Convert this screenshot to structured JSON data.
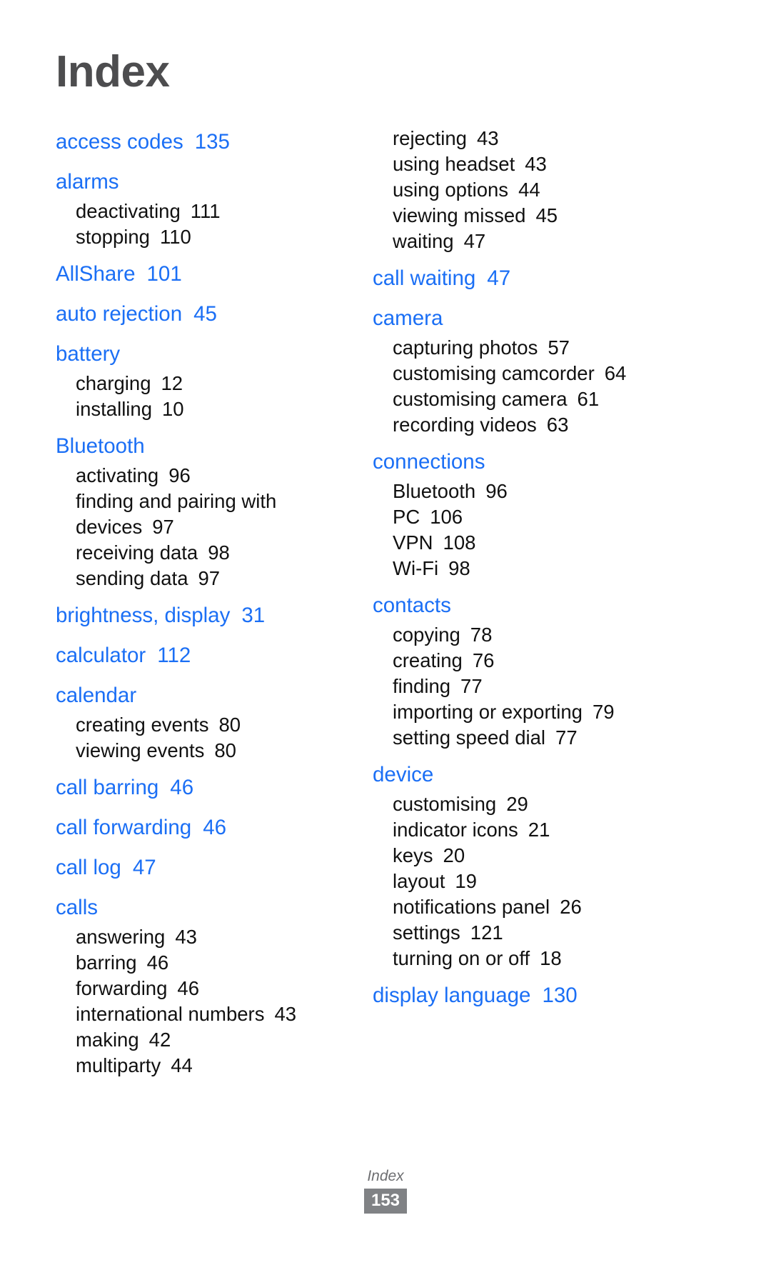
{
  "page": {
    "title": "Index",
    "footer_label": "Index",
    "footer_page_number": "153",
    "accent_color": "#1b6ff5",
    "title_color": "#4d4d4f",
    "body_color": "#111111",
    "footer_color": "#6d6e71",
    "footer_badge_color": "#808285"
  },
  "columns": [
    {
      "name": "left-column",
      "entries": [
        {
          "type": "head",
          "term": "access codes",
          "page": "135"
        },
        {
          "type": "head",
          "term": "alarms",
          "page": ""
        },
        {
          "type": "sub",
          "term": "deactivating",
          "page": "111"
        },
        {
          "type": "sub",
          "term": "stopping",
          "page": "110"
        },
        {
          "type": "head",
          "term": "AllShare",
          "page": "101"
        },
        {
          "type": "head",
          "term": "auto rejection",
          "page": "45"
        },
        {
          "type": "head",
          "term": "battery",
          "page": ""
        },
        {
          "type": "sub",
          "term": "charging",
          "page": "12"
        },
        {
          "type": "sub",
          "term": "installing",
          "page": "10"
        },
        {
          "type": "head",
          "term": "Bluetooth",
          "page": ""
        },
        {
          "type": "sub",
          "term": "activating",
          "page": "96"
        },
        {
          "type": "sub",
          "term": "finding and pairing with devices",
          "page": "97"
        },
        {
          "type": "sub",
          "term": "receiving data",
          "page": "98"
        },
        {
          "type": "sub",
          "term": "sending data",
          "page": "97"
        },
        {
          "type": "head",
          "term": "brightness, display",
          "page": "31"
        },
        {
          "type": "head",
          "term": "calculator",
          "page": "112"
        },
        {
          "type": "head",
          "term": "calendar",
          "page": ""
        },
        {
          "type": "sub",
          "term": "creating events",
          "page": "80"
        },
        {
          "type": "sub",
          "term": "viewing events",
          "page": "80"
        },
        {
          "type": "head",
          "term": "call barring",
          "page": "46"
        },
        {
          "type": "head",
          "term": "call forwarding",
          "page": "46"
        },
        {
          "type": "head",
          "term": "call log",
          "page": "47"
        },
        {
          "type": "head",
          "term": "calls",
          "page": ""
        },
        {
          "type": "sub",
          "term": "answering",
          "page": "43"
        },
        {
          "type": "sub",
          "term": "barring",
          "page": "46"
        },
        {
          "type": "sub",
          "term": "forwarding",
          "page": "46"
        },
        {
          "type": "sub",
          "term": "international numbers",
          "page": "43"
        },
        {
          "type": "sub",
          "term": "making",
          "page": "42"
        },
        {
          "type": "sub",
          "term": "multiparty",
          "page": "44"
        }
      ]
    },
    {
      "name": "right-column",
      "entries": [
        {
          "type": "sub",
          "term": "rejecting",
          "page": "43"
        },
        {
          "type": "sub",
          "term": "using headset",
          "page": "43"
        },
        {
          "type": "sub",
          "term": "using options",
          "page": "44"
        },
        {
          "type": "sub",
          "term": "viewing missed",
          "page": "45"
        },
        {
          "type": "sub",
          "term": "waiting",
          "page": "47"
        },
        {
          "type": "head",
          "term": "call waiting",
          "page": "47"
        },
        {
          "type": "head",
          "term": "camera",
          "page": ""
        },
        {
          "type": "sub",
          "term": "capturing photos",
          "page": "57"
        },
        {
          "type": "sub",
          "term": "customising camcorder",
          "page": "64"
        },
        {
          "type": "sub",
          "term": "customising camera",
          "page": "61"
        },
        {
          "type": "sub",
          "term": "recording videos",
          "page": "63"
        },
        {
          "type": "head",
          "term": "connections",
          "page": ""
        },
        {
          "type": "sub",
          "term": "Bluetooth",
          "page": "96"
        },
        {
          "type": "sub",
          "term": "PC",
          "page": "106"
        },
        {
          "type": "sub",
          "term": "VPN",
          "page": "108"
        },
        {
          "type": "sub",
          "term": "Wi-Fi",
          "page": "98"
        },
        {
          "type": "head",
          "term": "contacts",
          "page": ""
        },
        {
          "type": "sub",
          "term": "copying",
          "page": "78"
        },
        {
          "type": "sub",
          "term": "creating",
          "page": "76"
        },
        {
          "type": "sub",
          "term": "finding",
          "page": "77"
        },
        {
          "type": "sub",
          "term": "importing or exporting",
          "page": "79"
        },
        {
          "type": "sub",
          "term": "setting speed dial",
          "page": "77"
        },
        {
          "type": "head",
          "term": "device",
          "page": ""
        },
        {
          "type": "sub",
          "term": "customising",
          "page": "29"
        },
        {
          "type": "sub",
          "term": "indicator icons",
          "page": "21"
        },
        {
          "type": "sub",
          "term": "keys",
          "page": "20"
        },
        {
          "type": "sub",
          "term": "layout",
          "page": "19"
        },
        {
          "type": "sub",
          "term": "notifications panel",
          "page": "26"
        },
        {
          "type": "sub",
          "term": "settings",
          "page": "121"
        },
        {
          "type": "sub",
          "term": "turning on or off",
          "page": "18"
        },
        {
          "type": "head",
          "term": "display language",
          "page": "130"
        }
      ]
    }
  ]
}
